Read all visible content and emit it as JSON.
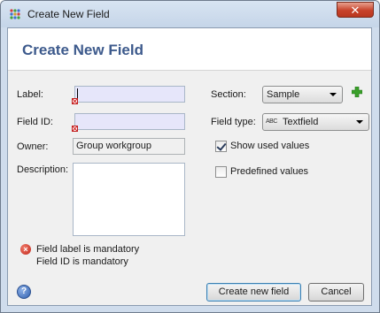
{
  "window": {
    "title": "Create New Field",
    "close_label": "✕"
  },
  "header": {
    "title": "Create New Field"
  },
  "form": {
    "label_label": "Label:",
    "label_value": "",
    "field_id_label": "Field ID:",
    "field_id_value": "",
    "owner_label": "Owner:",
    "owner_value": "Group workgroup",
    "description_label": "Description:",
    "description_value": "",
    "section_label": "Section:",
    "section_value": "Sample",
    "field_type_label": "Field type:",
    "field_type_icon_text": "ABC",
    "field_type_value": "Textfield",
    "show_used_values_label": "Show used values",
    "show_used_values_checked": true,
    "predefined_values_label": "Predefined values",
    "predefined_values_checked": false
  },
  "errors": {
    "icon_glyph": "×",
    "messages": [
      "Field label is mandatory",
      "Field ID is mandatory"
    ]
  },
  "footer": {
    "help_glyph": "?",
    "create_label": "Create new field",
    "cancel_label": "Cancel"
  },
  "icons": {
    "app": "app-grid-icon",
    "add": "plus-icon",
    "error": "error-icon",
    "help": "help-icon",
    "dropdown": "chevron-down-icon"
  },
  "colors": {
    "header_title": "#3d5a8c",
    "input_invalid_bg": "#e6e6fa",
    "error_red": "#c0261a",
    "add_green": "#3aa02a",
    "close_red": "#c7422a"
  }
}
